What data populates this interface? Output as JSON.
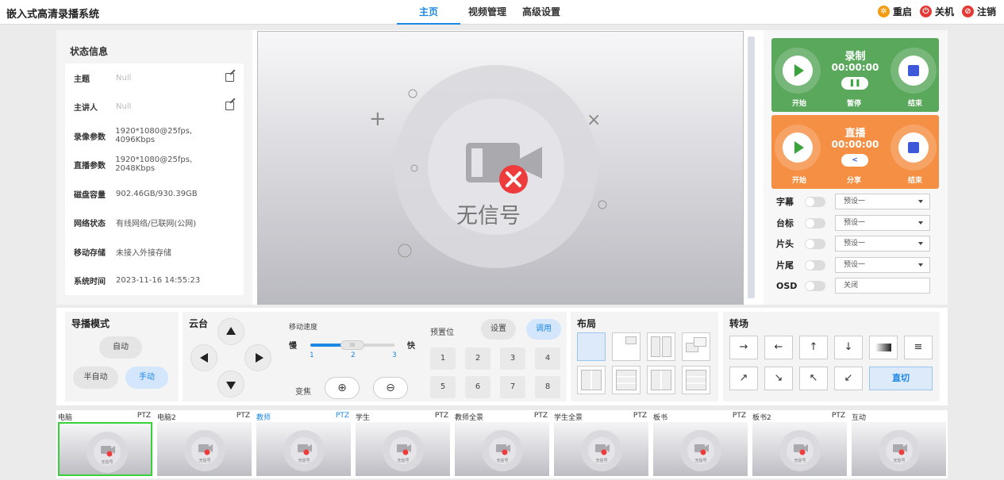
{
  "app": {
    "title": "嵌入式高清录播系统"
  },
  "nav": [
    {
      "label": "主页"
    },
    {
      "label": "视频管理"
    },
    {
      "label": "高级设置"
    }
  ],
  "system": {
    "restart": "重启",
    "shutdown": "关机",
    "logout": "注销"
  },
  "status": {
    "title": "状态信息",
    "rows": [
      {
        "label": "主题",
        "value": "Null"
      },
      {
        "label": "主讲人",
        "value": "Null"
      },
      {
        "label": "录像参数",
        "value": "1920*1080@25fps, 4096Kbps"
      },
      {
        "label": "直播参数",
        "value": "1920*1080@25fps, 2048Kbps"
      },
      {
        "label": "磁盘容量",
        "value": "902.46GB/930.39GB"
      },
      {
        "label": "网络状态",
        "value": "有线网络/已联网(公网)"
      },
      {
        "label": "移动存储",
        "value": "未接入外接存储"
      },
      {
        "label": "系统时间",
        "value": "2023-11-16 14:55:23"
      }
    ]
  },
  "preview": {
    "no_signal": "无信号"
  },
  "record": {
    "title": "录制",
    "time": "00:00:00",
    "start": "开始",
    "pause": "暂停",
    "end": "结束",
    "color": "#5aa85c"
  },
  "live": {
    "title": "直播",
    "time": "00:00:00",
    "start": "开始",
    "share": "分享",
    "end": "结束",
    "color": "#f48f44"
  },
  "options": [
    {
      "label": "字幕",
      "value": "预设一"
    },
    {
      "label": "台标",
      "value": "预设一"
    },
    {
      "label": "片头",
      "value": "预设一"
    },
    {
      "label": "片尾",
      "value": "预设一"
    },
    {
      "label": "OSD",
      "value": "关闭"
    }
  ],
  "director": {
    "title": "导播模式",
    "auto": "自动",
    "semi_auto": "半自动",
    "manual": "手动"
  },
  "ptz": {
    "title": "云台",
    "speed_label": "移动速度",
    "slow": "慢",
    "fast": "快",
    "ticks": [
      "1",
      "2",
      "3"
    ],
    "speed_level": 2,
    "zoom_label": "变焦"
  },
  "preset": {
    "title": "预置位",
    "set": "设置",
    "call": "调用",
    "numbers": [
      "1",
      "2",
      "3",
      "4",
      "5",
      "6",
      "7",
      "8"
    ]
  },
  "layout": {
    "title": "布局"
  },
  "transition": {
    "title": "转场",
    "direct_cut": "直切"
  },
  "thumbnails": [
    {
      "name": "电脑",
      "ptz": "PTZ",
      "selected": true
    },
    {
      "name": "电脑2",
      "ptz": "PTZ"
    },
    {
      "name": "教师",
      "ptz": "PTZ",
      "highlight": true
    },
    {
      "name": "学生",
      "ptz": "PTZ"
    },
    {
      "name": "教师全景",
      "ptz": "PTZ"
    },
    {
      "name": "学生全景",
      "ptz": "PTZ"
    },
    {
      "name": "板书",
      "ptz": "PTZ"
    },
    {
      "name": "板书2",
      "ptz": "PTZ"
    },
    {
      "name": "互动",
      "ptz": ""
    }
  ],
  "colors": {
    "accent": "#1e88e5",
    "selected_border": "#39d13b"
  }
}
